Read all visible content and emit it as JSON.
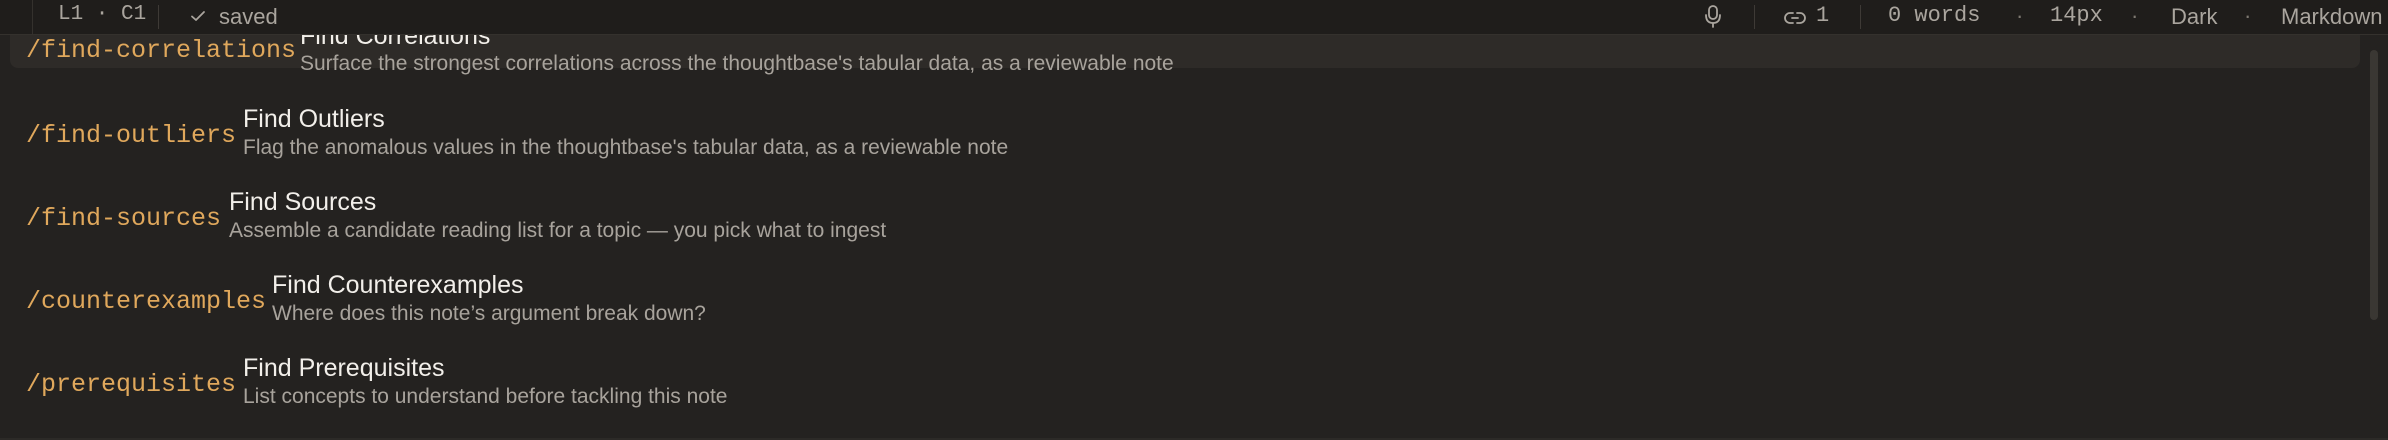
{
  "statusbar": {
    "cursor_position": "L1 · C1",
    "save_status": "saved",
    "backlinks_count": "1",
    "word_count": "0 words",
    "font_size": "14px",
    "theme": "Dark",
    "language": "Markdown",
    "separator": "·",
    "icons": [
      "checkmark-icon",
      "microphone-icon",
      "link-icon"
    ]
  },
  "commands": [
    {
      "command": "/find-correlations",
      "title": "Find Correlations",
      "description": "Surface the strongest correlations across the thoughtbase's tabular data, as a reviewable note"
    },
    {
      "command": "/find-outliers",
      "title": "Find Outliers",
      "description": "Flag the anomalous values in the thoughtbase's tabular data, as a reviewable note"
    },
    {
      "command": "/find-sources",
      "title": "Find Sources",
      "description": "Assemble a candidate reading list for a topic — you pick what to ingest"
    },
    {
      "command": "/counterexamples",
      "title": "Find Counterexamples",
      "description": "Where does this note’s argument break down?"
    },
    {
      "command": "/prerequisites",
      "title": "Find Prerequisites",
      "description": "List concepts to understand before tackling this note"
    }
  ],
  "colors": {
    "background": "#242220",
    "command": "#e0a85c",
    "title": "#f2efea",
    "description": "#a8a39c",
    "selected_row": "#2e2b28"
  }
}
